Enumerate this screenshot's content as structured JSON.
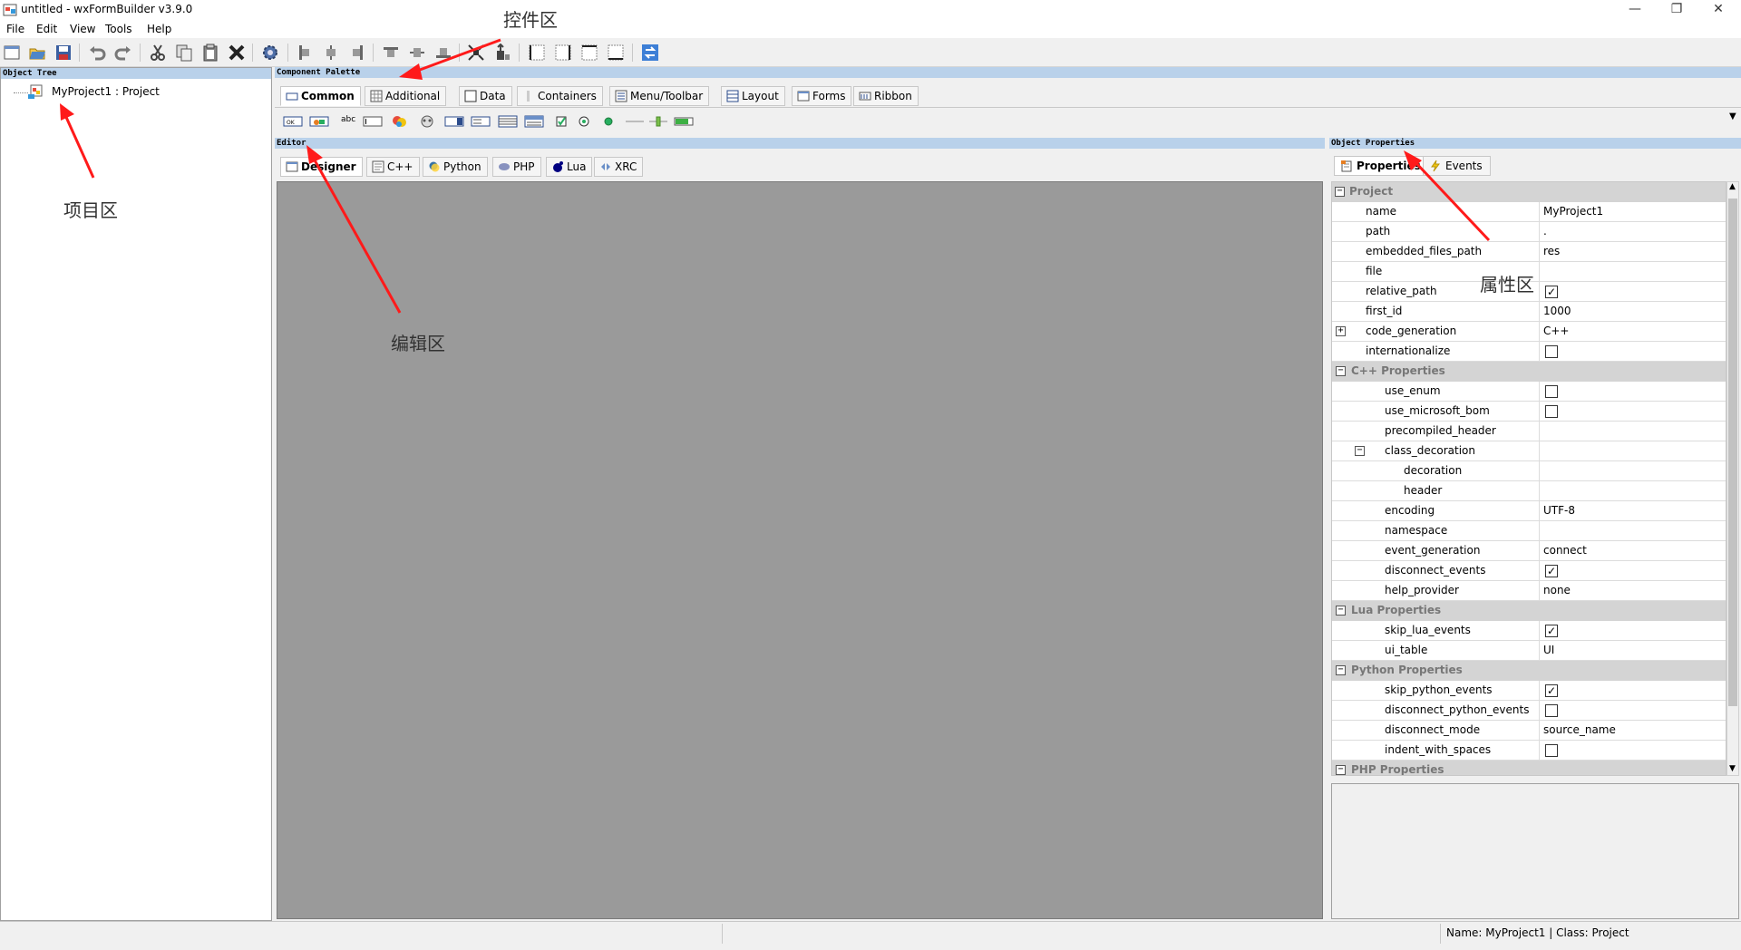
{
  "window": {
    "title": "untitled - wxFormBuilder v3.9.0",
    "minimize": "—",
    "maximize": "❐",
    "close": "✕"
  },
  "menu": [
    "File",
    "Edit",
    "View",
    "Tools",
    "Help"
  ],
  "toolbar": {
    "icons": [
      "new-icon",
      "open-icon",
      "save-icon",
      "undo-icon",
      "redo-icon",
      "cut-icon",
      "copy-icon",
      "paste-icon",
      "delete-icon",
      "generate-code-icon",
      "align-left-icon",
      "align-center-icon",
      "align-right-icon",
      "align-top-icon",
      "align-middle-icon",
      "align-bottom-icon",
      "expand-icon",
      "stretch-icon",
      "border-left-icon",
      "border-right-icon",
      "border-top-icon",
      "border-bottom-icon",
      "recursive-icon"
    ]
  },
  "object_tree": {
    "header": "Object Tree",
    "root_label": "MyProject1 : Project"
  },
  "palette": {
    "header": "Component Palette",
    "tabs": [
      "Common",
      "Additional",
      "Data",
      "Containers",
      "Menu/Toolbar",
      "Layout",
      "Forms",
      "Ribbon"
    ],
    "active_tab": "Common",
    "text_control_label": "abc"
  },
  "editor": {
    "header": "Editor",
    "tabs": [
      "Designer",
      "C++",
      "Python",
      "PHP",
      "Lua",
      "XRC"
    ],
    "active_tab": "Designer"
  },
  "properties": {
    "header": "Object Properties",
    "tabs": [
      "Properties",
      "Events"
    ],
    "active_tab": "Properties",
    "rows": [
      {
        "type": "cat",
        "name": "Project",
        "level": 0,
        "exp": "−"
      },
      {
        "name": "name",
        "value": "MyProject1",
        "level": 1
      },
      {
        "name": "path",
        "value": ".",
        "level": 1
      },
      {
        "name": "embedded_files_path",
        "value": "res",
        "level": 1
      },
      {
        "name": "file",
        "value": "",
        "level": 1
      },
      {
        "name": "relative_path",
        "check": true,
        "level": 1
      },
      {
        "name": "first_id",
        "value": "1000",
        "level": 1
      },
      {
        "name": "code_generation",
        "value": "C++",
        "level": 1,
        "exp": "+"
      },
      {
        "name": "internationalize",
        "check": false,
        "level": 1
      },
      {
        "type": "cat",
        "name": "C++ Properties",
        "level": 1,
        "exp": "−"
      },
      {
        "name": "use_enum",
        "check": false,
        "level": 2
      },
      {
        "name": "use_microsoft_bom",
        "check": false,
        "level": 2
      },
      {
        "name": "precompiled_header",
        "value": "",
        "level": 2
      },
      {
        "name": "class_decoration",
        "value": "",
        "level": 2,
        "exp": "−"
      },
      {
        "name": "decoration",
        "value": "",
        "level": 3
      },
      {
        "name": "header",
        "value": "",
        "level": 3
      },
      {
        "name": "encoding",
        "value": "UTF-8",
        "level": 2
      },
      {
        "name": "namespace",
        "value": "",
        "level": 2
      },
      {
        "name": "event_generation",
        "value": "connect",
        "level": 2
      },
      {
        "name": "disconnect_events",
        "check": true,
        "level": 2
      },
      {
        "name": "help_provider",
        "value": "none",
        "level": 2
      },
      {
        "type": "cat",
        "name": "Lua Properties",
        "level": 1,
        "exp": "−"
      },
      {
        "name": "skip_lua_events",
        "check": true,
        "level": 2
      },
      {
        "name": "ui_table",
        "value": "UI",
        "level": 2
      },
      {
        "type": "cat",
        "name": "Python Properties",
        "level": 1,
        "exp": "−"
      },
      {
        "name": "skip_python_events",
        "check": true,
        "level": 2
      },
      {
        "name": "disconnect_python_events",
        "check": false,
        "level": 2
      },
      {
        "name": "disconnect_mode",
        "value": "source_name",
        "level": 2
      },
      {
        "name": "indent_with_spaces",
        "check": false,
        "level": 2
      },
      {
        "type": "cat",
        "name": "PHP Properties",
        "level": 1,
        "exp": "−"
      }
    ]
  },
  "status": {
    "text": "Name: MyProject1 | Class: Project"
  },
  "annotations": {
    "palette": "控件区",
    "project": "项目区",
    "editor": "编辑区",
    "properties": "属性区"
  }
}
